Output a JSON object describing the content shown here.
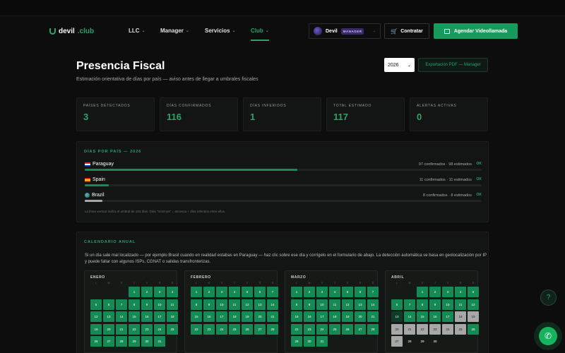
{
  "brand": {
    "name": "devil",
    "suffix": ".club"
  },
  "nav": [
    {
      "label": "LLC",
      "active": false
    },
    {
      "label": "Manager",
      "active": false
    },
    {
      "label": "Servicios",
      "active": false
    },
    {
      "label": "Club",
      "active": true
    }
  ],
  "user": {
    "name": "Devil",
    "role": "MANAGER"
  },
  "actions": {
    "contratar": "Contratar",
    "agendar": "Agendar Videollamada"
  },
  "page": {
    "title": "Presencia Fiscal",
    "subtitle": "Estimación orientativa de días por país — aviso antes de llegar a umbrales fiscales",
    "year": "2026",
    "export_label": "Exportación PDF — Manager"
  },
  "stats": [
    {
      "label": "PAÍSES DETECTADOS",
      "value": "3"
    },
    {
      "label": "DÍAS CONFIRMADOS",
      "value": "116"
    },
    {
      "label": "DÍAS INFERIDOS",
      "value": "1"
    },
    {
      "label": "TOTAL ESTIMADO",
      "value": "117"
    },
    {
      "label": "ALERTAS ACTIVAS",
      "value": "0"
    }
  ],
  "by_country": {
    "heading": "DÍAS POR PAÍS — 2026",
    "countries": [
      {
        "name": "Paraguay",
        "stats": "97 confirmados · 98 estimados",
        "status": "OK",
        "fraction": 0.536,
        "color": "#168a55"
      },
      {
        "name": "Spain",
        "stats": "11 confirmados · 11 estimados",
        "status": "OK",
        "fraction": 0.06,
        "color": "#168a55"
      },
      {
        "name": "Brazil",
        "stats": "8 confirmados · 8 estimados",
        "status": "OK",
        "fraction": 0.044,
        "color": "#a7a7a7"
      }
    ],
    "note": "La línea vertical indica el umbral de 183 días. Días \"mínimos\" = ancesca + días inferidos entre ellos."
  },
  "calendar": {
    "heading": "CALENDARIO ANUAL",
    "intro": "Si un día sale mal localizado — por ejemplo Brasil cuando en realidad estabas en Paraguay — haz clic sobre ese día y corrígelo en el formulario de abajo. La detección automática se basa en geolocalización por IP y puede fallar con algunos ISPs, CGNAT o salidas transfronterizas.",
    "weekdays": [
      "L",
      "M",
      "X",
      "J",
      "V",
      "S",
      "D"
    ],
    "months": [
      {
        "name": "ENERO",
        "offset": 3,
        "days": [
          "c",
          "c",
          "c",
          "c",
          "c",
          "c",
          "c",
          "c",
          "c",
          "c",
          "c",
          "c",
          "c",
          "c",
          "c",
          "c",
          "c",
          "c",
          "c",
          "c",
          "c",
          "c",
          "c",
          "c",
          "c",
          "c",
          "c",
          "c",
          "c",
          "c",
          "c"
        ]
      },
      {
        "name": "FEBRERO",
        "offset": 0,
        "days": [
          "c",
          "c",
          "c",
          "c",
          "c",
          "c",
          "c",
          "c",
          "c",
          "c",
          "c",
          "c",
          "c",
          "c",
          "c",
          "c",
          "c",
          "c",
          "c",
          "c",
          "c",
          "c",
          "c",
          "c",
          "c",
          "c",
          "c",
          "c"
        ]
      },
      {
        "name": "MARZO",
        "offset": 0,
        "days": [
          "c",
          "c",
          "c",
          "c",
          "c",
          "c",
          "c",
          "c",
          "c",
          "c",
          "c",
          "c",
          "c",
          "c",
          "c",
          "c",
          "c",
          "c",
          "c",
          "c",
          "c",
          "c",
          "c",
          "c",
          "c",
          "c",
          "c",
          "c",
          "c",
          "c",
          "c"
        ]
      },
      {
        "name": "ABRIL",
        "offset": 2,
        "days": [
          "c",
          "c",
          "c",
          "c",
          "c",
          "c",
          "c",
          "c",
          "c",
          "c",
          "c",
          "c",
          "i",
          "c",
          "c",
          "c",
          "c",
          "e",
          "e",
          "e",
          "e",
          "e",
          "e",
          "e",
          "e",
          "c",
          "e",
          "n",
          "n",
          "n"
        ]
      }
    ]
  }
}
